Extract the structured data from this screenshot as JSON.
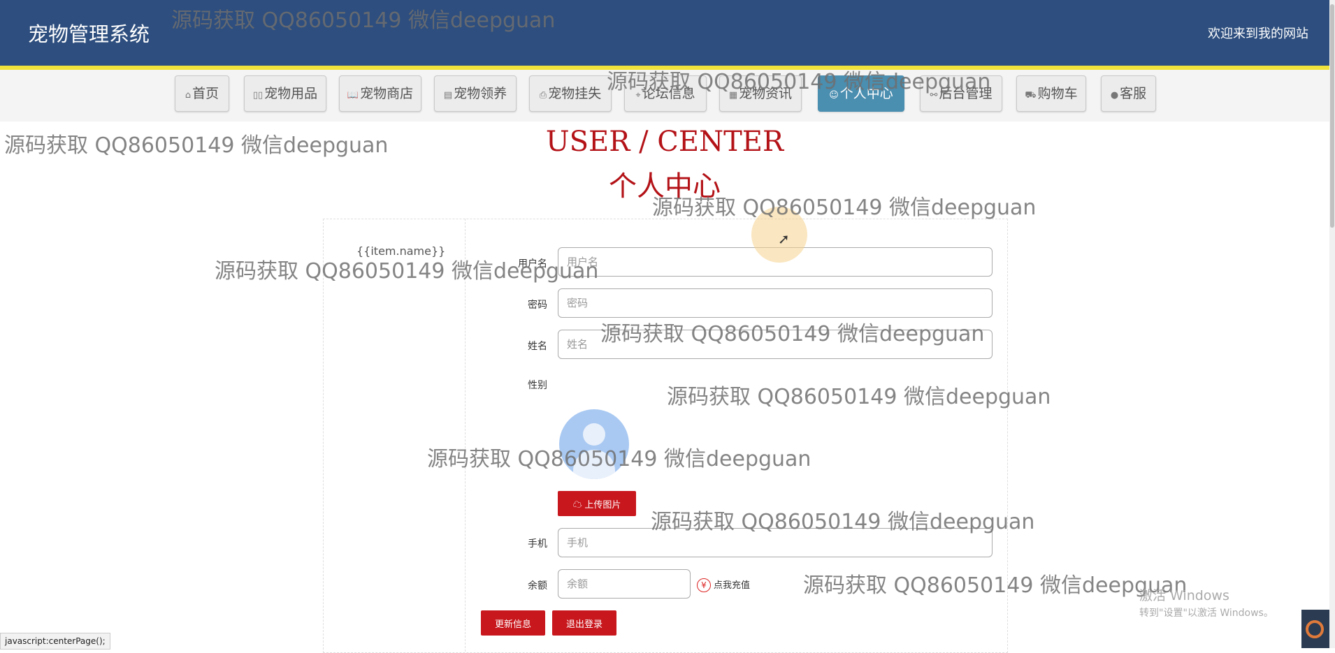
{
  "header": {
    "title": "宠物管理系统",
    "welcome": "欢迎来到我的网站"
  },
  "nav": {
    "items": [
      {
        "label": "首页",
        "icon": "home-icon"
      },
      {
        "label": "宠物用品",
        "icon": "goods-icon"
      },
      {
        "label": "宠物商店",
        "icon": "book-icon"
      },
      {
        "label": "宠物领养",
        "icon": "note-icon"
      },
      {
        "label": "宠物挂失",
        "icon": "printer-icon"
      },
      {
        "label": "论坛信息",
        "icon": "tag-icon"
      },
      {
        "label": "宠物资讯",
        "icon": "news-icon"
      },
      {
        "label": "个人中心",
        "icon": "user-icon",
        "active": true
      },
      {
        "label": "后台管理",
        "icon": "link-icon"
      },
      {
        "label": "购物车",
        "icon": "cart-icon"
      },
      {
        "label": "客服",
        "icon": "chat-icon"
      }
    ]
  },
  "page": {
    "heading_en": "USER / CENTER",
    "heading_cn": "个人中心",
    "left_menu_item": "{{item.name}}"
  },
  "form": {
    "username": {
      "label": "用户名",
      "placeholder": "用户名"
    },
    "password": {
      "label": "密码",
      "placeholder": "密码"
    },
    "name": {
      "label": "姓名",
      "placeholder": "姓名"
    },
    "gender": {
      "label": "性别"
    },
    "upload_button": "上传图片",
    "phone": {
      "label": "手机",
      "placeholder": "手机"
    },
    "balance": {
      "label": "余额",
      "placeholder": "余额"
    },
    "recharge_text": "点我充值",
    "recharge_symbol": "¥",
    "update_button": "更新信息",
    "logout_button": "退出登录"
  },
  "status_bar": "javascript:centerPage();",
  "watermark": "源码获取 QQ86050149 微信deepguan",
  "os_overlay": {
    "title": "激活 Windows",
    "subtitle": "转到\"设置\"以激活 Windows。"
  },
  "colors": {
    "header_bg": "#2d4e7e",
    "accent_red": "#c8171d",
    "nav_active": "#4a8eb0",
    "header_stripe": "#f0e23a"
  }
}
